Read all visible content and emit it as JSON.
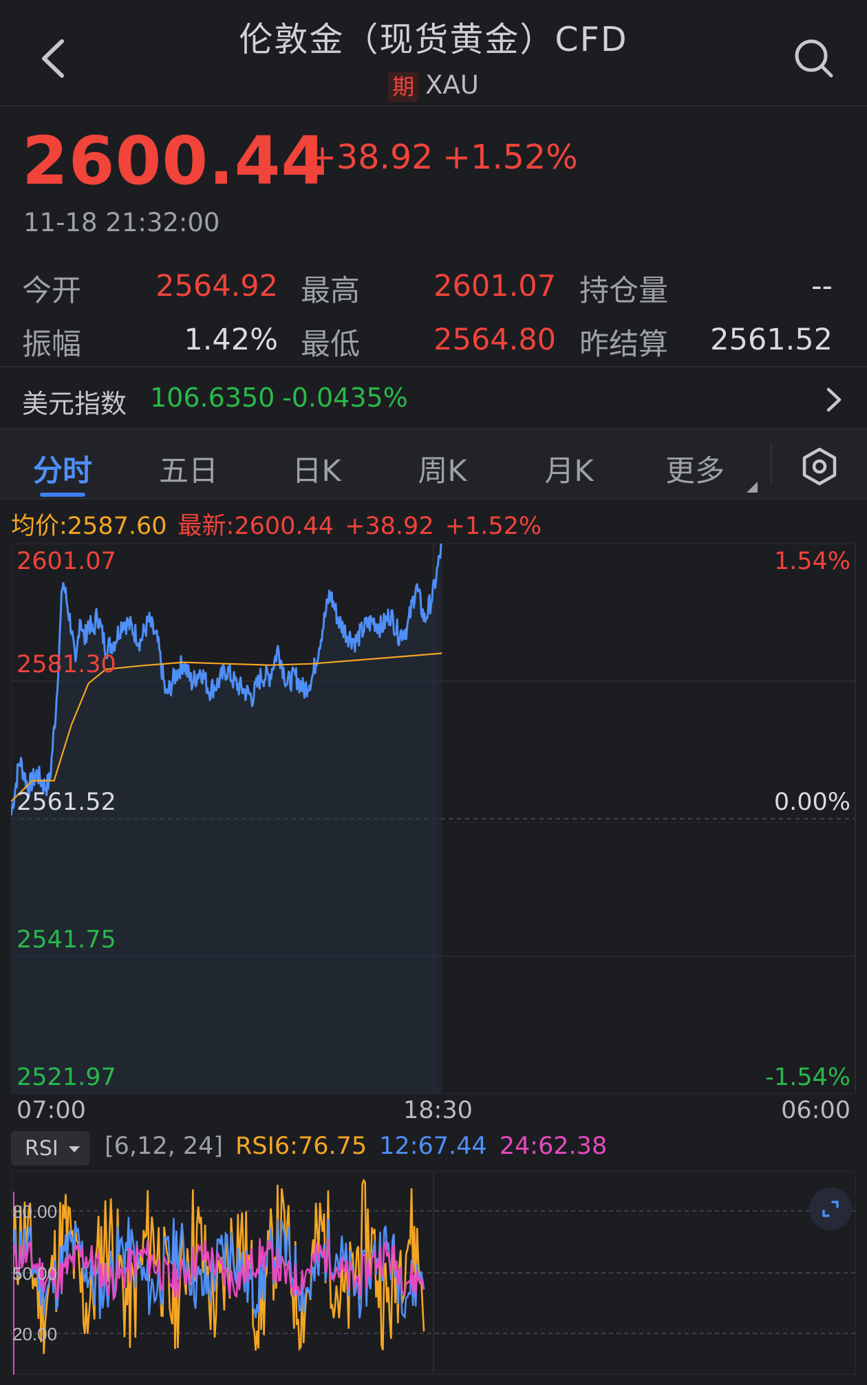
{
  "header": {
    "title": "伦敦金（现货黄金）CFD",
    "badge": "期",
    "symbol": "XAU"
  },
  "quote": {
    "price": "2600.44",
    "change": "+38.92",
    "change_pct": "+1.52%",
    "timestamp": "11-18 21:32:00"
  },
  "stats": {
    "open_label": "今开",
    "open_value": "2564.92",
    "high_label": "最高",
    "high_value": "2601.07",
    "oi_label": "持仓量",
    "oi_value": "--",
    "amp_label": "振幅",
    "amp_value": "1.42%",
    "low_label": "最低",
    "low_value": "2564.80",
    "settle_label": "昨结算",
    "settle_value": "2561.52"
  },
  "usd_index": {
    "label": "美元指数",
    "value": "106.6350",
    "change": "-0.0435%"
  },
  "tabs": [
    "分时",
    "五日",
    "日K",
    "周K",
    "月K",
    "更多"
  ],
  "chart_header": {
    "avg": "均价:2587.60",
    "latest": "最新:2600.44",
    "change": "+38.92",
    "change_pct": "+1.52%"
  },
  "chart_data": {
    "type": "line",
    "y_ticks": [
      "2601.07",
      "2581.30",
      "2561.52",
      "2541.75",
      "2521.97"
    ],
    "pct_ticks": [
      "1.54%",
      "0.00%",
      "-1.54%"
    ],
    "x_ticks": [
      "07:00",
      "18:30",
      "06:00"
    ],
    "ylim": [
      2521.97,
      2601.07
    ],
    "reference": 2561.52,
    "series": [
      {
        "color": "#4f8ff7",
        "x": [
          0,
          0.02,
          0.04,
          0.06,
          0.08,
          0.09,
          0.105,
          0.12,
          0.14,
          0.15,
          0.16,
          0.17,
          0.18,
          0.19,
          0.2,
          0.22,
          0.24,
          0.26,
          0.28,
          0.3,
          0.32,
          0.34,
          0.36,
          0.38,
          0.4,
          0.42,
          0.44,
          0.46,
          0.48,
          0.5,
          0.52,
          0.54,
          0.56,
          0.58,
          0.6,
          0.62,
          0.64,
          0.66,
          0.68,
          0.7,
          0.72,
          0.74,
          0.76,
          0.78,
          0.8,
          0.82,
          0.84,
          0.86,
          0.88,
          0.9,
          0.92,
          0.94,
          0.96,
          0.98,
          1.0
        ],
        "values": [
          2562,
          2570,
          2566,
          2568,
          2566,
          2567,
          2578,
          2596,
          2589,
          2583,
          2591,
          2587,
          2590,
          2588,
          2591,
          2586,
          2587,
          2590,
          2589,
          2587,
          2590,
          2587,
          2579,
          2582,
          2584,
          2581,
          2583,
          2580,
          2581,
          2583,
          2581,
          2580,
          2579,
          2582,
          2582,
          2586,
          2581,
          2582,
          2580,
          2582,
          2588,
          2594,
          2590,
          2588,
          2587,
          2589,
          2590,
          2589,
          2591,
          2588,
          2589,
          2595,
          2590,
          2594,
          2601
        ]
      },
      {
        "color": "#f5a623",
        "x": [
          0,
          0.05,
          0.1,
          0.14,
          0.18,
          0.22,
          0.3,
          0.4,
          0.5,
          0.6,
          0.7,
          0.8,
          0.9,
          1.0
        ],
        "values": [
          2564,
          2567,
          2567,
          2575,
          2581,
          2583,
          2583.5,
          2584,
          2583.8,
          2583.6,
          2583.8,
          2584.3,
          2584.8,
          2585.3
        ]
      }
    ],
    "fill_extent": 0.51
  },
  "rsi": {
    "selector": "RSI",
    "params": "[6,12, 24]",
    "rsi6": "RSI6:76.75",
    "rsi12": "12:67.44",
    "rsi24": "24:62.38",
    "levels": [
      "80.00",
      "50.00",
      "20.00"
    ]
  },
  "colors": {
    "up": "#f1443a",
    "down": "#29b94a",
    "accent": "#4f8ff7",
    "avg": "#f5a623",
    "rsi24": "#e64ac0"
  }
}
